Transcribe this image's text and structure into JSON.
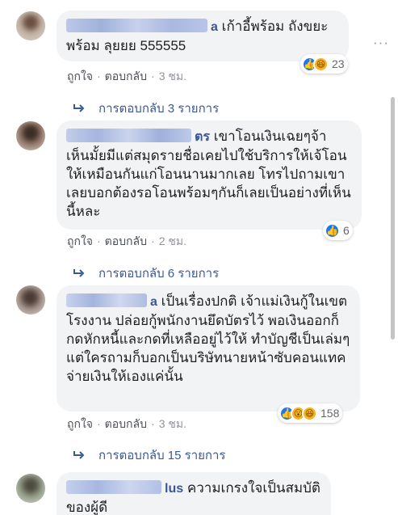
{
  "comments": [
    {
      "author_tail": "a",
      "text": "เก้าอี้พร้อม ถังขยะพร้อม ลุยยย 555555",
      "like_label": "ถูกใจ",
      "reply_label": "ตอบกลับ",
      "time": "3 ชม.",
      "reaction_count": "23",
      "replies_label": "การตอบกลับ 3 รายการ"
    },
    {
      "author_tail": "ตร",
      "text": "เขาโอนเงินเฉยๆจ้า เห็นมั้ยมีแต่สมุดรายชื่อเคยไปใช้บริการให้เจ้โอนให้เหมือนกันแก่โอนนานมากเลย โทรไปถามเขาเลยบอกต้องรอโอนพร้อมๆกันก็เลยเป็นอย่างที่เห็นนี้หละ",
      "like_label": "ถูกใจ",
      "reply_label": "ตอบกลับ",
      "time": "2 ชม.",
      "reaction_count": "6",
      "replies_label": "การตอบกลับ 6 รายการ"
    },
    {
      "author_tail": "a",
      "text": "เป็นเรื่องปกติ เจ้าแม่เงินกู้ในเขตโรงงาน ปล่อยกู้พนักงานยึดบัตรไว้ พอเงินออกก็กดหักหนี้และกดที่เหลืออยู่ไว้ให้ ทำบัญชีเป็นเล่มๆ แต่ใครถามก็บอกเป็นบริษัทนายหน้าซับคอนแทคจ่ายเงินให้เองแค่นั้น",
      "like_label": "ถูกใจ",
      "reply_label": "ตอบกลับ",
      "time": "3 ชม.",
      "reaction_count": "158",
      "replies_label": "การตอบกลับ 15 รายการ"
    },
    {
      "author_tail": "lus",
      "text": "ความเกรงใจเป็นสมบัติของผู้ดี"
    }
  ],
  "more_icon": "ellipsis-icon",
  "colors": {
    "link": "#385898",
    "bubble": "#f2f3f5",
    "meta": "#90949c",
    "like": "#1877f2"
  }
}
